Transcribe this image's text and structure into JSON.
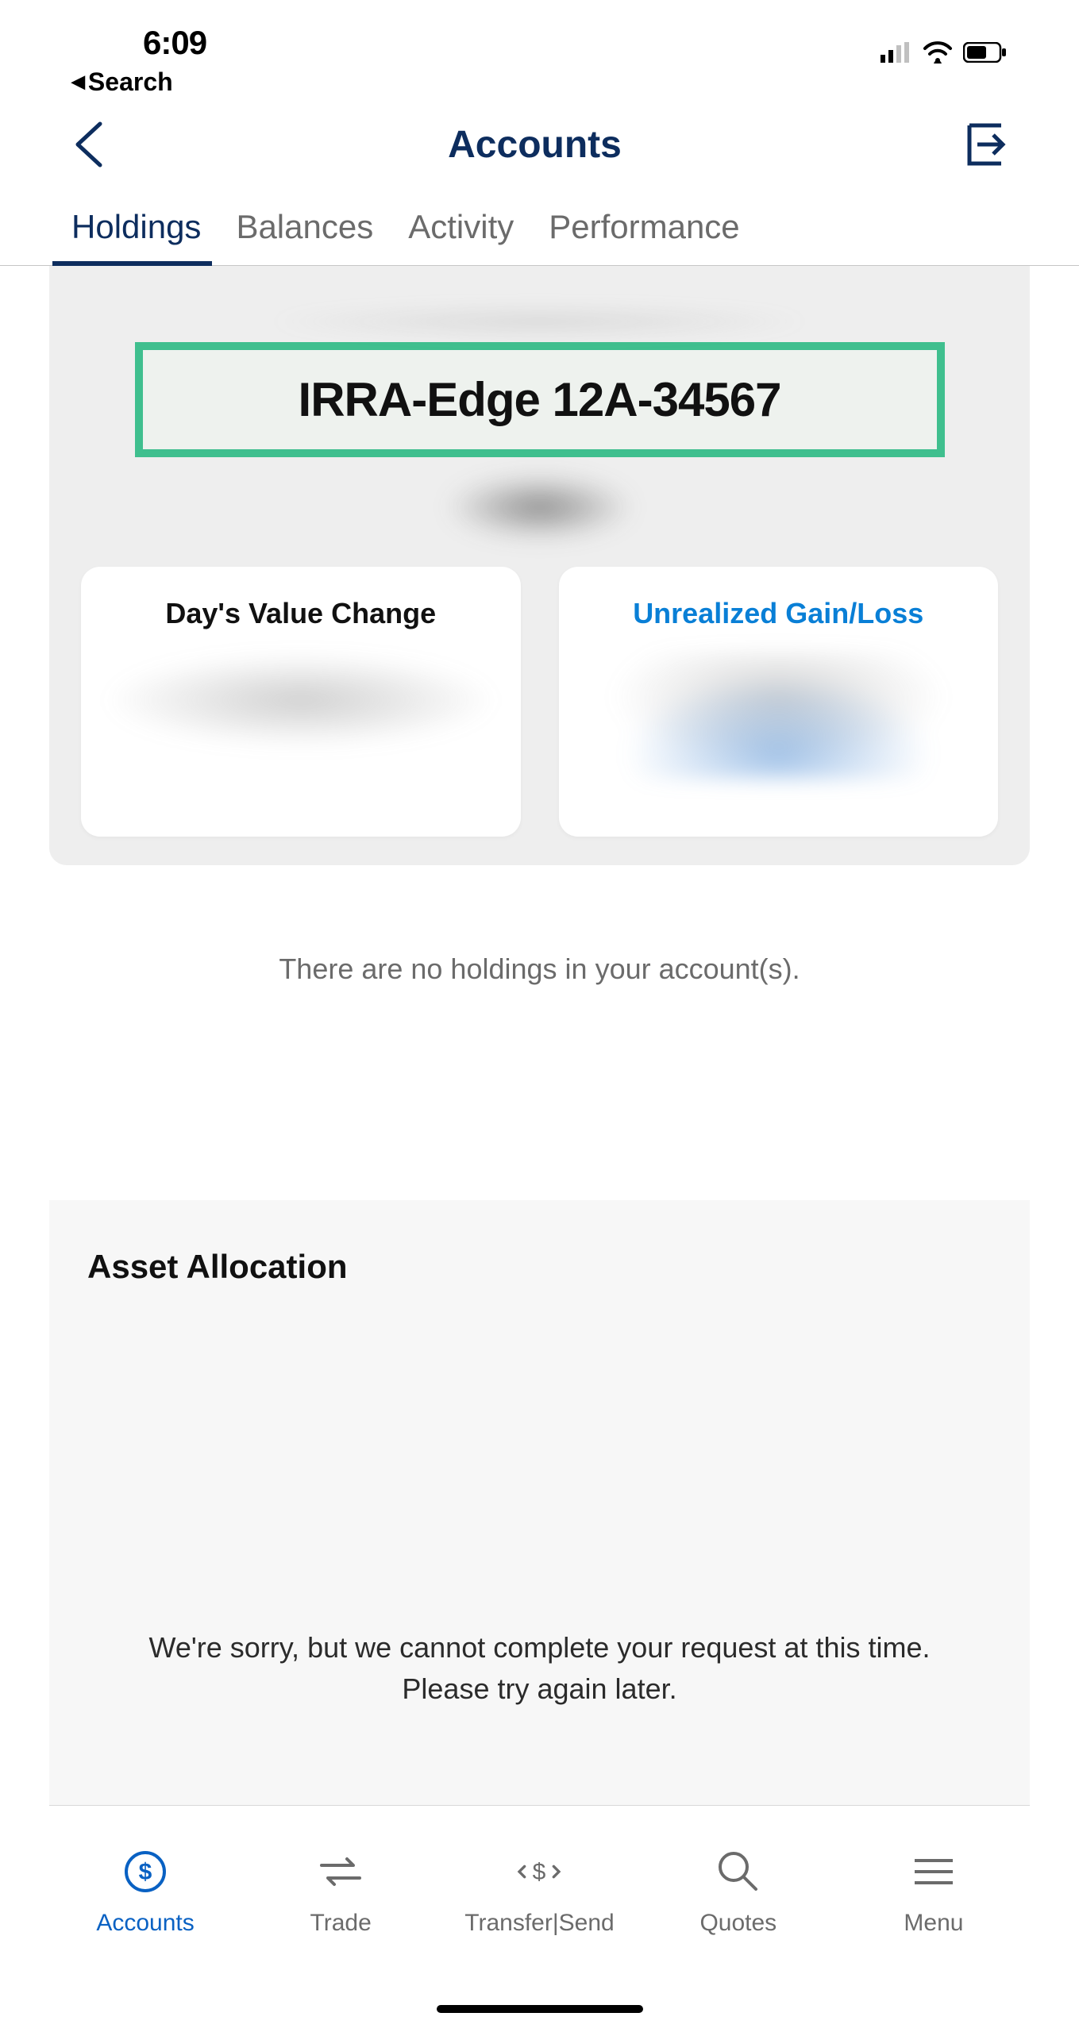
{
  "status": {
    "time": "6:09",
    "back_label": "Search"
  },
  "header": {
    "title": "Accounts"
  },
  "tabs": [
    {
      "label": "Holdings",
      "active": true
    },
    {
      "label": "Balances",
      "active": false
    },
    {
      "label": "Activity",
      "active": false
    },
    {
      "label": "Performance",
      "active": false
    }
  ],
  "account": {
    "name": "IRRA-Edge 12A-34567"
  },
  "cards": {
    "day_change": {
      "title": "Day's Value Change"
    },
    "unrealized": {
      "title": "Unrealized Gain/Loss"
    }
  },
  "messages": {
    "no_holdings": "There are no holdings in your account(s).",
    "asset_allocation_title": "Asset Allocation",
    "asset_error_line1": "We're sorry, but we cannot complete your request at this time.",
    "asset_error_line2": "Please try again later."
  },
  "bottom_nav": [
    {
      "label": "Accounts"
    },
    {
      "label": "Trade"
    },
    {
      "label": "Transfer|Send"
    },
    {
      "label": "Quotes"
    },
    {
      "label": "Menu"
    }
  ]
}
